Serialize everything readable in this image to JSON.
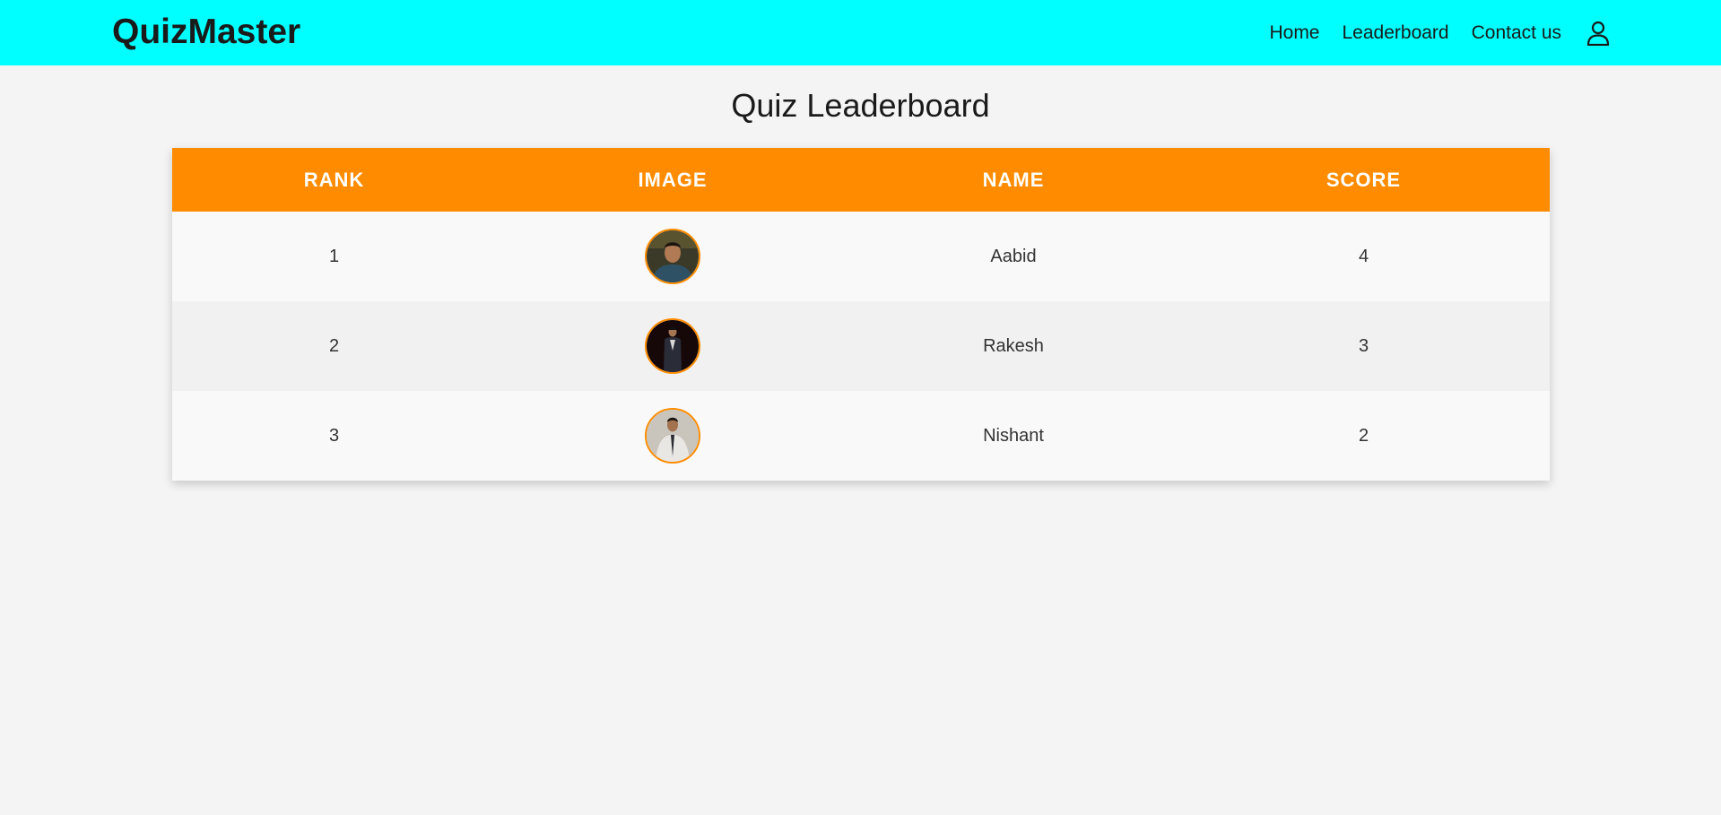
{
  "brand": "QuizMaster",
  "nav": {
    "home": "Home",
    "leaderboard": "Leaderboard",
    "contact": "Contact us",
    "user_icon": "user-icon"
  },
  "page_title": "Quiz Leaderboard",
  "table": {
    "headers": [
      "RANK",
      "IMAGE",
      "NAME",
      "SCORE"
    ],
    "rows": [
      {
        "rank": "1",
        "name": "Aabid",
        "score": "4"
      },
      {
        "rank": "2",
        "name": "Rakesh",
        "score": "3"
      },
      {
        "rank": "3",
        "name": "Nishant",
        "score": "2"
      }
    ]
  },
  "colors": {
    "navbar": "#00ffff",
    "header": "#ff8c00",
    "background": "#f4f4f4"
  }
}
